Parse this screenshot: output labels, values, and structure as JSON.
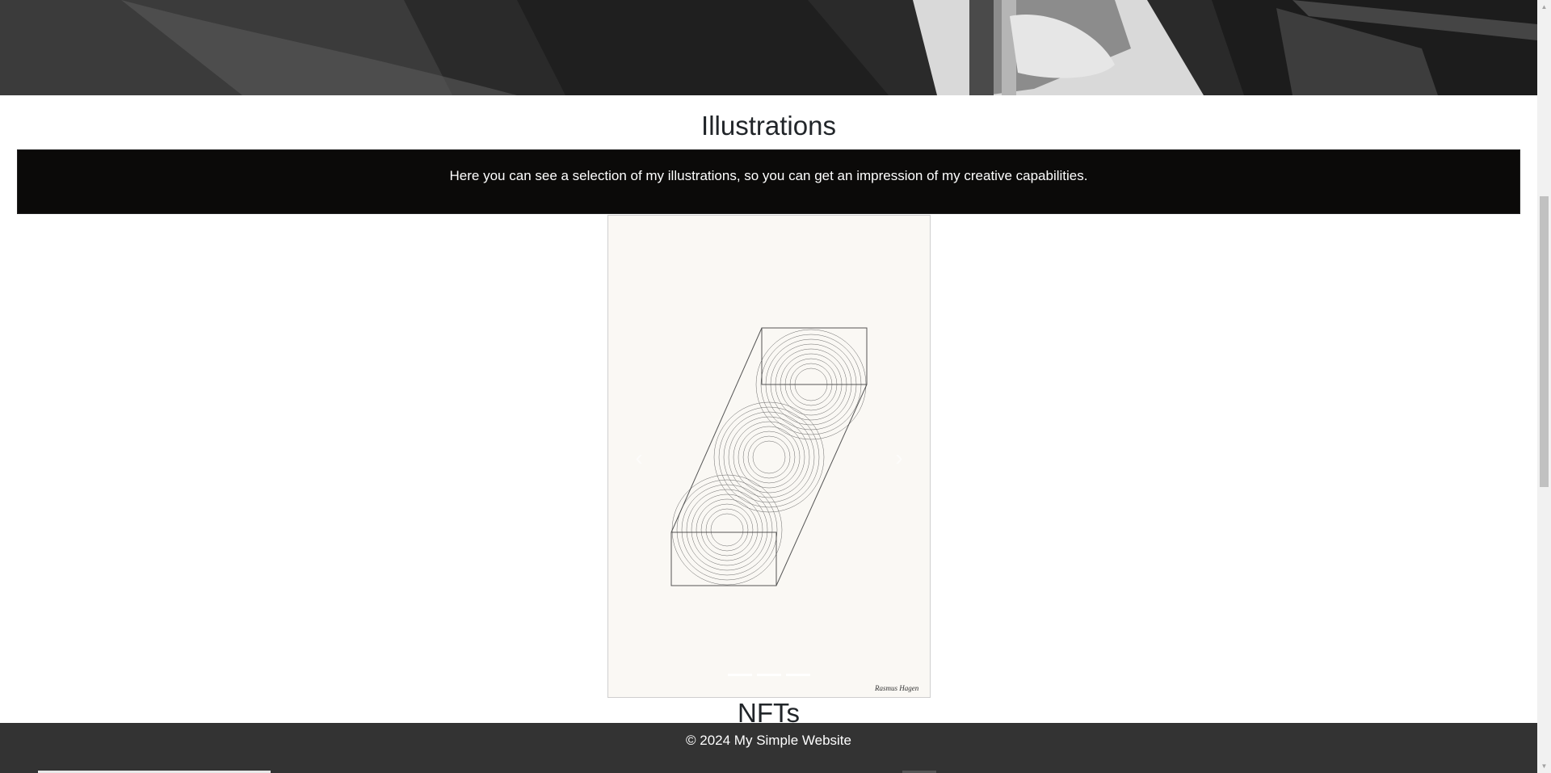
{
  "illustrations": {
    "title": "Illustrations",
    "intro": "Here you can see a selection of my illustrations, so you can get an impression of my creative capabilities.",
    "carousel": {
      "prev_icon": "chevron-left-icon",
      "next_icon": "chevron-right-icon",
      "signature": "Rasmus Hagen"
    }
  },
  "nfts": {
    "title": "NFTs"
  },
  "footer": {
    "copyright": "© 2024 My Simple Website"
  },
  "colors": {
    "intro_band": "#0b0a09",
    "footer": "#333333",
    "background": "#ffffff"
  }
}
